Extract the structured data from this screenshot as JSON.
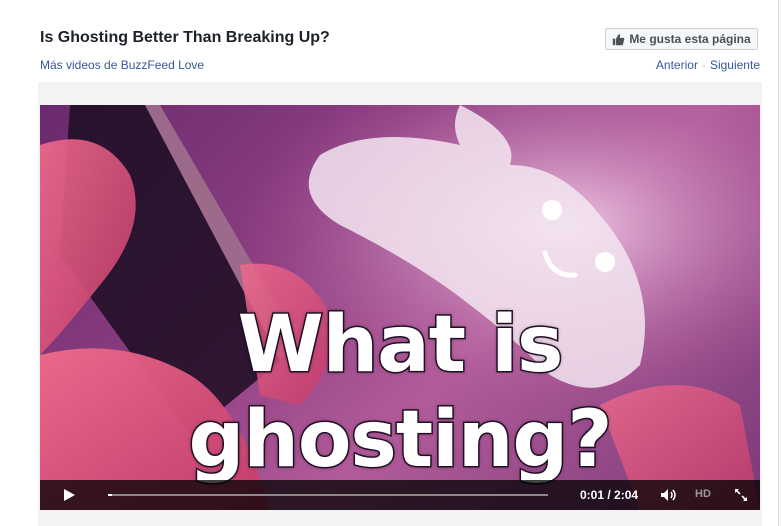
{
  "video": {
    "title": "Is Ghosting Better Than Breaking Up?",
    "more_videos_link": "Más videos de BuzzFeed Love",
    "caption_line1": "What is",
    "caption_line2": "ghosting?"
  },
  "page_actions": {
    "like_page_label": "Me gusta esta página",
    "like_icon": "thumbs-up-icon"
  },
  "navigation": {
    "previous_label": "Anterior",
    "separator": "·",
    "next_label": "Siguiente"
  },
  "player": {
    "time_display": "0:01 / 2:04",
    "progress_fraction": 0.008,
    "quality_label": "HD",
    "icons": {
      "play": "play-icon",
      "volume": "volume-icon",
      "fullscreen": "fullscreen-icon"
    }
  },
  "colors": {
    "link": "#365899",
    "title": "#1d2129",
    "controls_bg": "#000000"
  }
}
